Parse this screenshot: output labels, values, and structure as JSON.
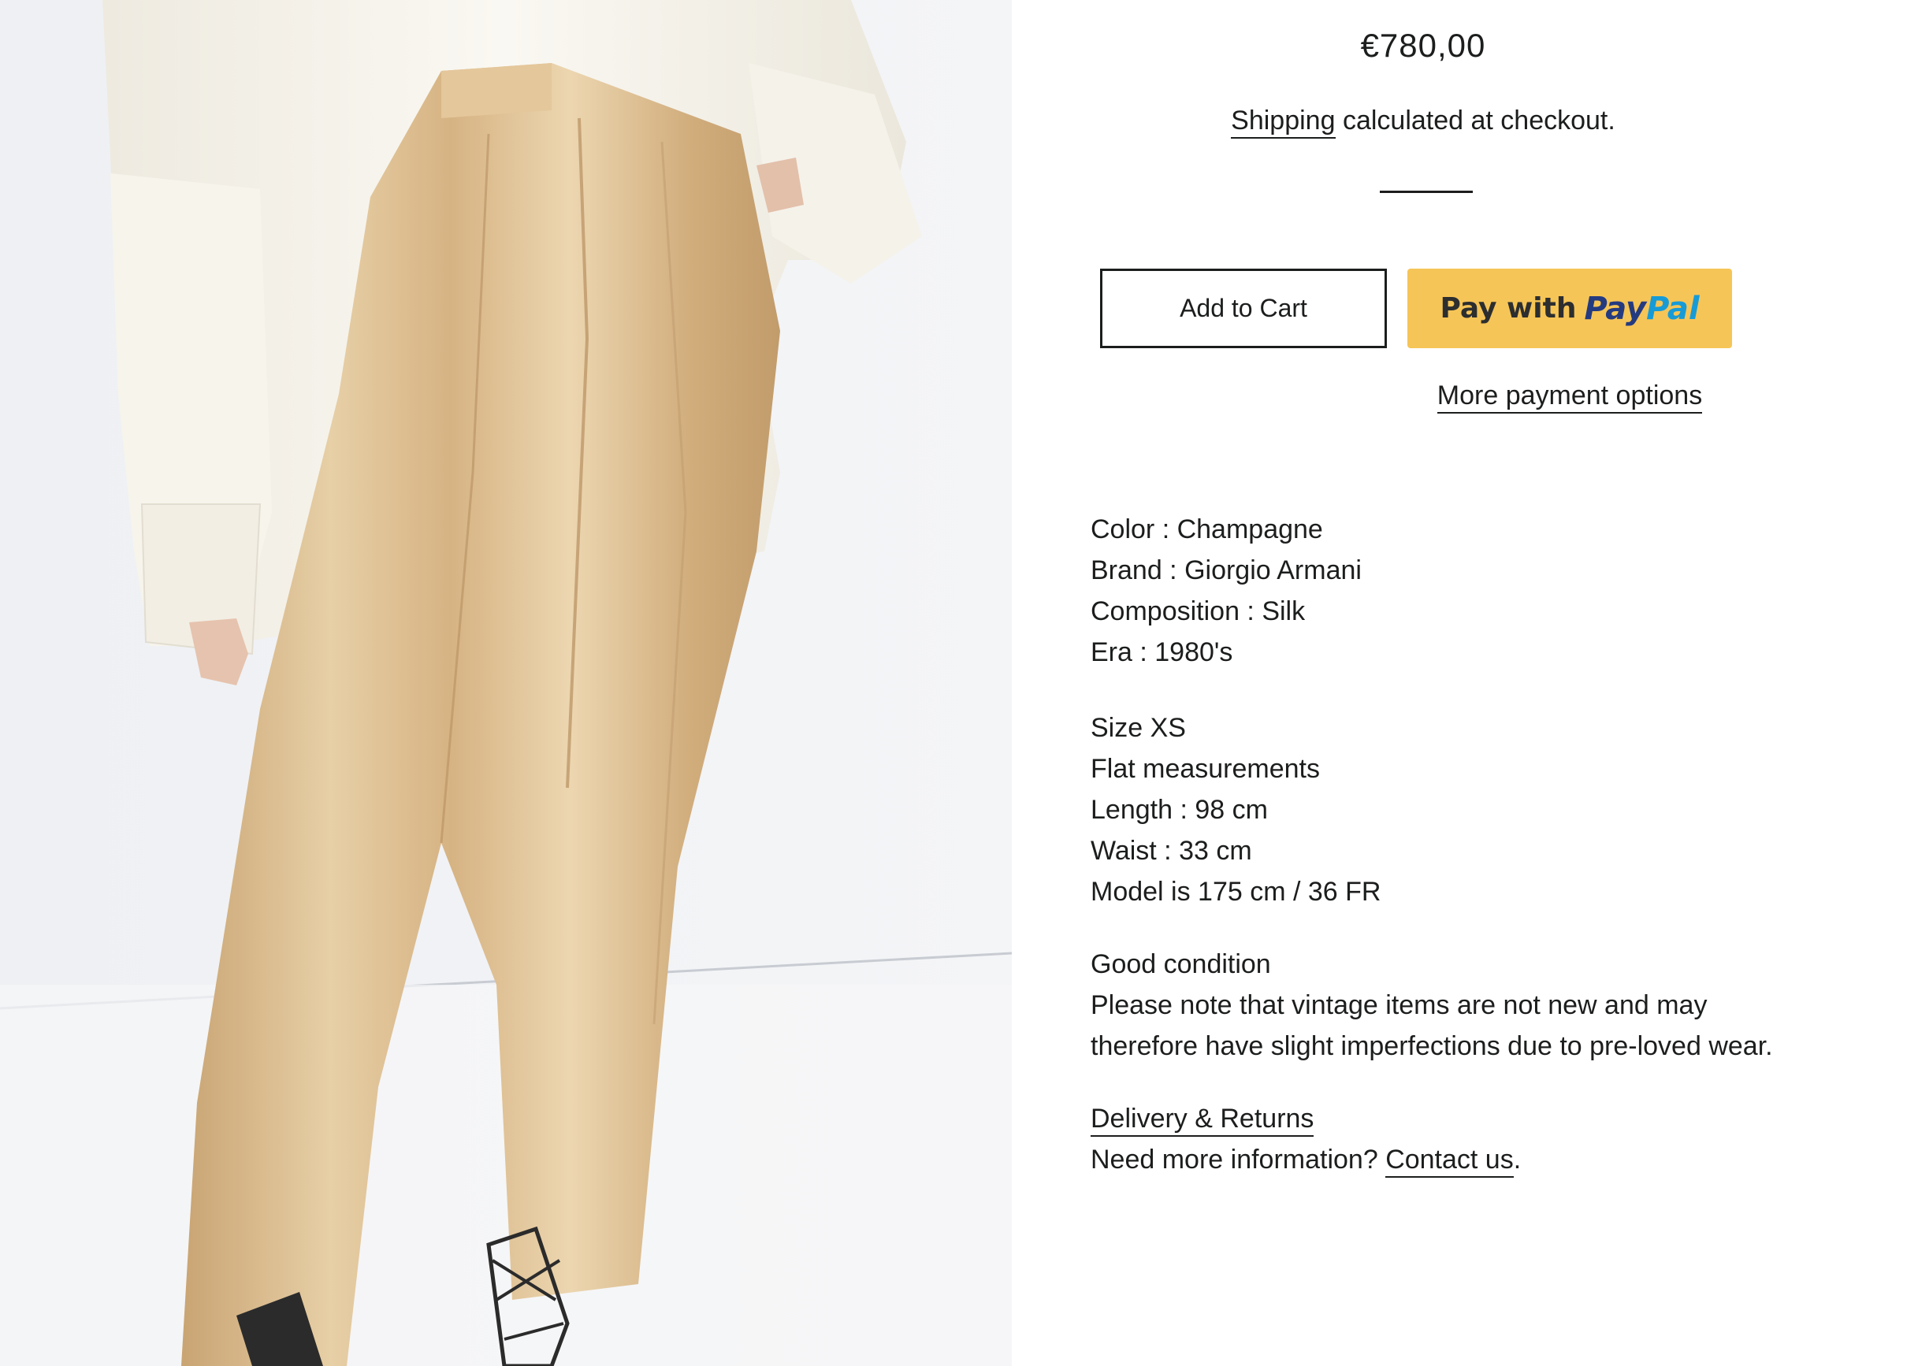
{
  "product": {
    "price": "€780,00",
    "shipping_link": "Shipping",
    "shipping_suffix": " calculated at checkout.",
    "add_to_cart_label": "Add to Cart",
    "paypal_prefix": "Pay with",
    "paypal_logo_pay": "Pay",
    "paypal_logo_pal": "Pal",
    "more_payment_options": "More payment options"
  },
  "attributes": [
    "Color : Champagne",
    "Brand : Giorgio Armani",
    "Composition : Silk",
    "Era : 1980's"
  ],
  "sizing": [
    "Size XS",
    "Flat measurements",
    "Length : 98 cm",
    "Waist : 33 cm",
    "Model is 175 cm / 36 FR"
  ],
  "condition": {
    "title": "Good condition",
    "note": "Please note that vintage items are not new and may therefore have slight imperfections due to pre-loved wear."
  },
  "footer": {
    "delivery_link": "Delivery & Returns",
    "need_info_prefix": "Need more information? ",
    "contact_link": "Contact us",
    "contact_suffix": "."
  },
  "colors": {
    "text": "#1c1d1d",
    "paypal_button": "#f6c557",
    "paypal_blue_dark": "#253b80",
    "paypal_blue_light": "#179bd7",
    "trousers": "#d9b88a",
    "shirt": "#f4f0e6"
  },
  "icons": {
    "paypal": "paypal-logo-icon"
  }
}
